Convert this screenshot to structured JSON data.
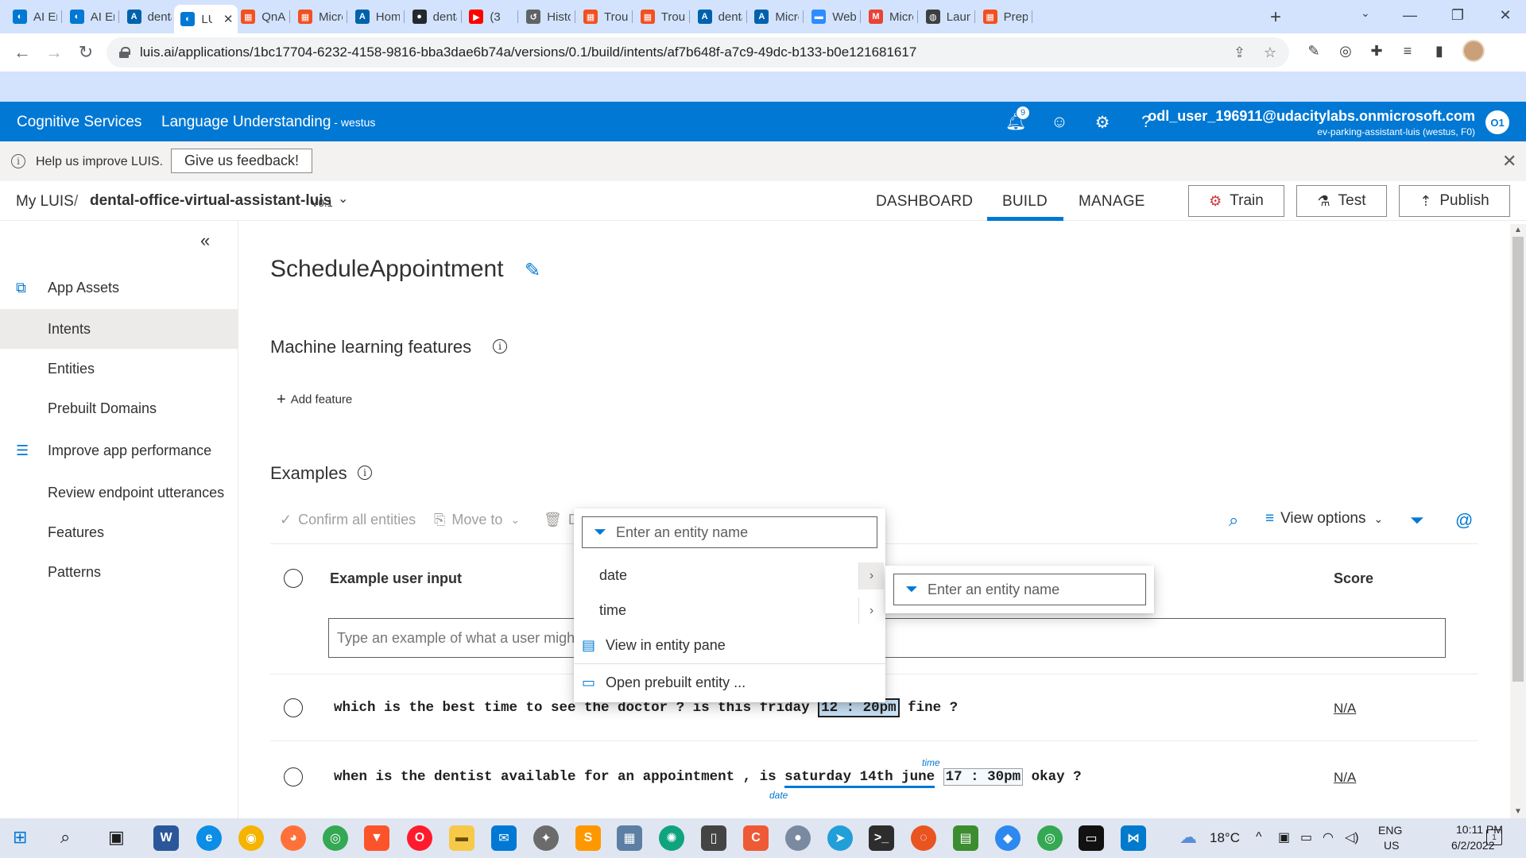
{
  "browser": {
    "tabs": [
      {
        "title": "AI En",
        "icon": "luis-tab-icon",
        "color": "#0078d4"
      },
      {
        "title": "AI En",
        "icon": "luis-tab-icon",
        "color": "#0078d4"
      },
      {
        "title": "denta",
        "icon": "azure-tab-icon",
        "color": "#0062ad"
      },
      {
        "title": "LU",
        "icon": "luis-tab-icon",
        "color": "#0078d4",
        "active": true
      },
      {
        "title": "QnA",
        "icon": "microsoft-tab-icon",
        "color": "#f25022"
      },
      {
        "title": "Micro",
        "icon": "microsoft-tab-icon",
        "color": "#f25022"
      },
      {
        "title": "Home",
        "icon": "azure-tab-icon",
        "color": "#0062ad"
      },
      {
        "title": "denta",
        "icon": "github-tab-icon",
        "color": "#24292f"
      },
      {
        "title": "(3",
        "icon": "youtube-tab-icon",
        "color": "#ff0000"
      },
      {
        "title": "Histo",
        "icon": "history-tab-icon",
        "color": "#5f6368"
      },
      {
        "title": "Troub",
        "icon": "microsoft-tab-icon",
        "color": "#f25022"
      },
      {
        "title": "Troub",
        "icon": "microsoft-tab-icon",
        "color": "#f25022"
      },
      {
        "title": "denta",
        "icon": "azure-tab-icon",
        "color": "#0062ad"
      },
      {
        "title": "Micro",
        "icon": "azure-tab-icon",
        "color": "#0062ad"
      },
      {
        "title": "Webi",
        "icon": "zoom-tab-icon",
        "color": "#2d8cff"
      },
      {
        "title": "Micro",
        "icon": "gmail-tab-icon",
        "color": "#ea4335"
      },
      {
        "title": "Launc",
        "icon": "globe-tab-icon",
        "color": "#3c4043"
      },
      {
        "title": "Prepa",
        "icon": "microsoft-tab-icon",
        "color": "#f25022"
      }
    ],
    "active_tab_close": "✕",
    "new_tab": "+",
    "url": "luis.ai/applications/1bc17704-6232-4158-9816-bba3dae6b74a/versions/0.1/build/intents/af7b648f-a7c9-49dc-b133-b0e121681617"
  },
  "header": {
    "brand": "Cognitive Services",
    "product": "Language Understanding",
    "region": " - westus",
    "notification_count": "9",
    "user_email": "odl_user_196911@udacitylabs.onmicrosoft.com",
    "user_resource": "ev-parking-assistant-luis (westus, F0)",
    "user_initials": "O1",
    "accent_color": "#0078d4"
  },
  "feedback": {
    "text": "Help us improve LUIS.",
    "button": "Give us feedback!"
  },
  "nav": {
    "crumb_root": "My LUIS",
    "crumb_sep": "/",
    "app_name": "dental-office-virtual-assistant-luis",
    "version": "V0.1",
    "tabs": [
      "DASHBOARD",
      "BUILD",
      "MANAGE"
    ],
    "active_tab": "BUILD",
    "train": "Train",
    "test": "Test",
    "publish": "Publish"
  },
  "sidebar": {
    "items": [
      {
        "label": "App Assets",
        "icon": "app-assets-icon"
      },
      {
        "label": "Intents",
        "selected": true
      },
      {
        "label": "Entities"
      },
      {
        "label": "Prebuilt Domains"
      },
      {
        "label": "Improve app performance",
        "icon": "sliders-icon"
      },
      {
        "label": "Review endpoint utterances"
      },
      {
        "label": "Features"
      },
      {
        "label": "Patterns"
      }
    ]
  },
  "main": {
    "intent_title": "ScheduleAppointment",
    "ml_features_heading": "Machine learning features",
    "add_feature": "Add feature",
    "examples_heading": "Examples",
    "toolbar": {
      "confirm_all": "Confirm all entities",
      "move_to": "Move to",
      "delete_partial": "D",
      "view_options": "View options"
    },
    "columns": {
      "example": "Example user input",
      "score": "Score"
    },
    "input_placeholder": "Type an example of what a user might say and hit Enter.",
    "utterances": [
      {
        "before": "which is the best time to see the doctor ? is this friday ",
        "entity": "12 : 20pm",
        "after": " fine ?",
        "score": "N/A"
      },
      {
        "before": "when is the dentist available for an appointment , is ",
        "date_entity": "saturday 14th june",
        "date_label": "date",
        "mid": " ",
        "time_entity": "17 : 30pm",
        "time_label": "time",
        "after": " okay ?",
        "score": "N/A"
      }
    ]
  },
  "entity_menu": {
    "filter_placeholder": "Enter an entity name",
    "items": [
      "date",
      "time"
    ],
    "view_in_pane": "View in entity pane",
    "open_prebuilt": "Open prebuilt entity ...",
    "submenu_placeholder": "Enter an entity name"
  },
  "taskbar": {
    "temperature": "18°C",
    "lang1": "ENG",
    "lang2": "US",
    "time": "10:11 PM",
    "date": "6/2/2022",
    "notifications": "1"
  }
}
